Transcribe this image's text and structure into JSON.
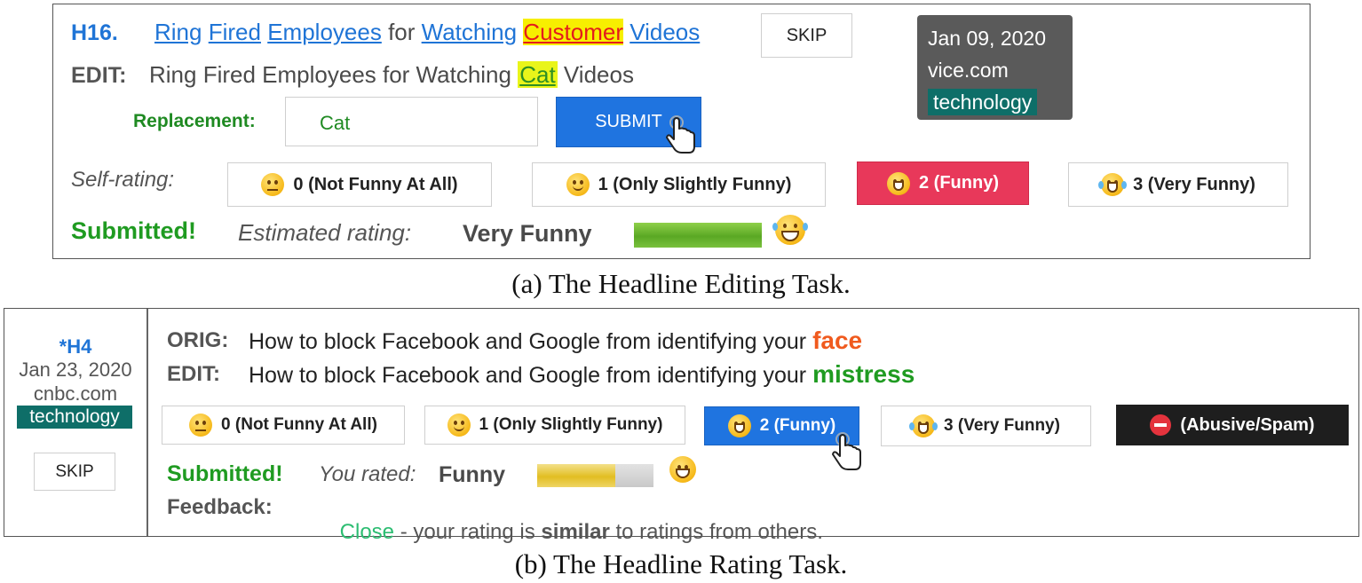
{
  "editing": {
    "headline_id": "H16.",
    "orig_parts": [
      "Ring",
      "Fired",
      "Employees",
      "for",
      "Watching",
      "Customer",
      "Videos"
    ],
    "skip_label": "SKIP",
    "meta": {
      "date": "Jan 09, 2020",
      "source": "vice.com",
      "category": "technology"
    },
    "edit_label": "EDIT:",
    "edit_before": "Ring Fired Employees for Watching",
    "edit_word": "Cat",
    "edit_after": "Videos",
    "replacement_label": "Replacement:",
    "replacement_value": "Cat",
    "submit_label": "SUBMIT",
    "self_rating_label": "Self-rating:",
    "ratings": [
      "0 (Not Funny At All)",
      "1 (Only Slightly Funny)",
      "2 (Funny)",
      "3 (Very Funny)"
    ],
    "submitted_label": "Submitted!",
    "estimated_label": "Estimated rating:",
    "estimated_value": "Very Funny",
    "estimated_fraction": 1.0
  },
  "editing_caption": "(a) The Headline Editing Task.",
  "rating": {
    "headline_id": "*H4",
    "meta": {
      "date": "Jan 23, 2020",
      "source": "cnbc.com",
      "category": "technology"
    },
    "skip_label": "SKIP",
    "orig_label": "ORIG:",
    "orig_text": "How to block Facebook and Google from identifying your",
    "orig_word": "face",
    "edit_label": "EDIT:",
    "edit_text": "How to block Facebook and Google from identifying your",
    "edit_word": "mistress",
    "ratings": [
      "0 (Not Funny At All)",
      "1 (Only Slightly Funny)",
      "2 (Funny)",
      "3 (Very Funny)",
      "(Abusive/Spam)"
    ],
    "submitted_label": "Submitted!",
    "you_rated_label": "You rated:",
    "you_rated_value": "Funny",
    "rated_fraction": 0.67,
    "feedback_label": "Feedback:",
    "feedback_close": "Close",
    "feedback_mid": " - your rating is ",
    "feedback_similar": "similar",
    "feedback_end": " to ratings from others."
  },
  "rating_caption": "(b) The Headline Rating Task.",
  "colors": {
    "blue": "#1f74d6",
    "green": "#1f9b21",
    "red_button": "#e8385a",
    "blue_button": "#1f74e0",
    "teal_badge": "#0e6e68"
  }
}
